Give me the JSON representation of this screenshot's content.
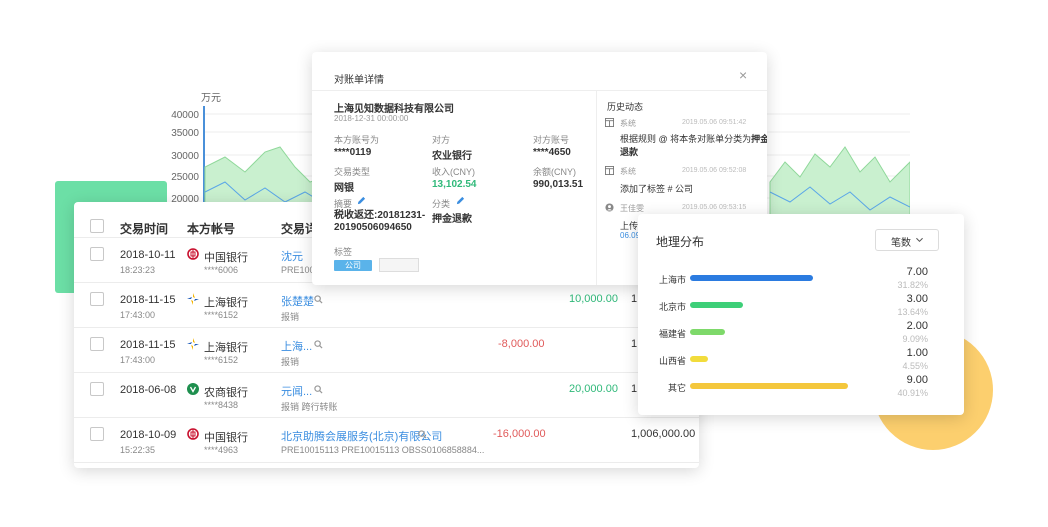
{
  "background_chart": {
    "unit": "万元",
    "yticks": [
      "40000",
      "35000",
      "30000",
      "25000",
      "20000"
    ]
  },
  "table": {
    "headers": [
      "交易时间",
      "本方帐号",
      "交易详情"
    ],
    "rows": [
      {
        "date": "2018-10-11",
        "time": "18:23:23",
        "bank": "中国银行",
        "bank_type": "boc",
        "acct": "****6006",
        "counterparty": "沈元",
        "note": "PRE10015"
      },
      {
        "date": "2018-11-15",
        "time": "17:43:00",
        "bank": "上海银行",
        "bank_type": "shb",
        "acct": "****6152",
        "counterparty": "张楚楚",
        "note": "报销",
        "credit": "10,000.00",
        "balance": "1"
      },
      {
        "date": "2018-11-15",
        "time": "17:43:00",
        "bank": "上海银行",
        "bank_type": "shb",
        "acct": "****6152",
        "counterparty": "上海...",
        "note": "报销",
        "debit": "-8,000.00",
        "balance": "1"
      },
      {
        "date": "2018-06-08",
        "time": "",
        "bank": "农商银行",
        "bank_type": "rcb",
        "acct": "****8438",
        "counterparty": "元闻...",
        "note": "报销 跨行转账",
        "credit": "20,000.00",
        "balance": "1"
      },
      {
        "date": "2018-10-09",
        "time": "15:22:35",
        "bank": "中国银行",
        "bank_type": "boc",
        "acct": "****4963",
        "counterparty": "北京助腾会展服务(北京)有限公司",
        "note": "PRE10015113 PRE10015113 OBSS0106858884...",
        "debit": "-16,000.00",
        "balance": "1,006,000.00"
      }
    ]
  },
  "detail": {
    "title": "对账单详情",
    "close": "×",
    "company": "上海见知数据科技有限公司",
    "date": "2018-12-31 00:00:00",
    "fields": {
      "acct_label": "本方账号为",
      "acct_value": "****0119",
      "cp_label": "对方",
      "cp_value": "农业银行",
      "cp_acct_label": "对方账号",
      "cp_acct_value": "****4650",
      "type_label": "交易类型",
      "type_value": "网银",
      "income_label": "收入(CNY)",
      "income_value": "13,102.54",
      "balance_label": "余额(CNY)",
      "balance_value": "990,013.51",
      "summary_label": "摘要",
      "summary_value": "税收返还:20181231-20190506094650",
      "category_label": "分类",
      "category_value": "押金退款",
      "tag_label": "标签",
      "tag_value": "公司"
    },
    "history": {
      "title": "历史动态",
      "items": [
        {
          "who": "系统",
          "time": "2019.05.06 09:51:42",
          "text1": "根据规则 @ 将本条对账单分类为",
          "highlight": "押金",
          "text2": "退款"
        },
        {
          "who": "系统",
          "time": "2019.05.06 09:52:08",
          "text1": "添加了标签 # 公司"
        },
        {
          "who": "王佳雯",
          "time": "2019.05.06 09:53:15",
          "text1": "上传",
          "text2": "06.09..."
        }
      ]
    }
  },
  "geo": {
    "title": "地理分布",
    "dropdown": "笔数",
    "items": [
      {
        "name": "上海市",
        "value": "7.00",
        "pct": "31.82%",
        "fraction": 0.778,
        "color": "#2b7be0"
      },
      {
        "name": "北京市",
        "value": "3.00",
        "pct": "13.64%",
        "fraction": 0.333,
        "color": "#3dcf78"
      },
      {
        "name": "福建省",
        "value": "2.00",
        "pct": "9.09%",
        "fraction": 0.222,
        "color": "#7ed96a"
      },
      {
        "name": "山西省",
        "value": "1.00",
        "pct": "4.55%",
        "fraction": 0.111,
        "color": "#f2dc3c"
      },
      {
        "name": "其它",
        "value": "9.00",
        "pct": "40.91%",
        "fraction": 1.0,
        "color": "#f4c73c"
      }
    ]
  }
}
